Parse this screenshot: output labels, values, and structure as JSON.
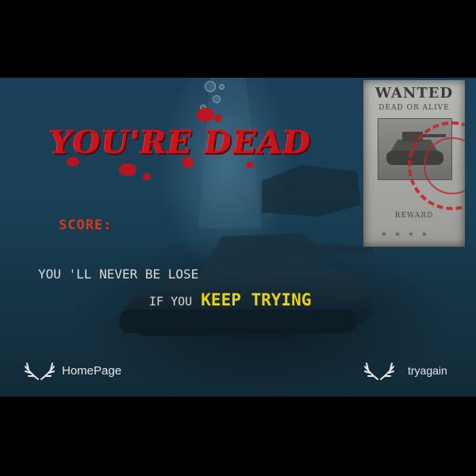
{
  "title": "YOU'RE DEAD",
  "score": {
    "label": "SCORE:",
    "value": ""
  },
  "message": {
    "line1": "YOU 'LL NEVER BE LOSE",
    "line2_prefix": "IF YOU",
    "line2_highlight": "KEEP TRYING"
  },
  "poster": {
    "heading": "WANTED",
    "subheading": "DEAD OR ALIVE",
    "reward": "REWARD"
  },
  "buttons": {
    "home": "HomePage",
    "retry": "tryagain"
  },
  "colors": {
    "title": "#c8141c",
    "score": "#d8381a",
    "highlight": "#e6d21c",
    "message": "#d9d9d9",
    "water": "#1a4158"
  },
  "icons": {
    "button": "antler-icon"
  }
}
